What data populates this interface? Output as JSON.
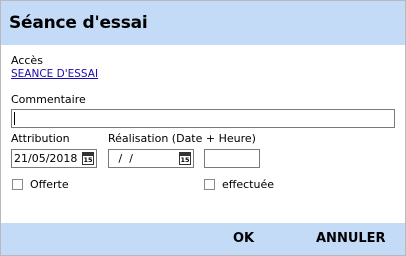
{
  "dialog": {
    "title": "Séance d'essai"
  },
  "acces": {
    "label": "Accès",
    "link_text": "SEANCE D'ESSAI"
  },
  "commentaire": {
    "label": "Commentaire",
    "value": ""
  },
  "attribution": {
    "label": "Attribution",
    "date_value": "21/05/2018"
  },
  "realisation": {
    "label": "Réalisation (Date + Heure)",
    "date_value": " /  /",
    "time_value": ""
  },
  "calendar_icon_text": "15",
  "options": {
    "offerte_label": "Offerte",
    "offerte_checked": false,
    "effectuee_label": "effectuée",
    "effectuee_checked": false
  },
  "buttons": {
    "ok_label": "OK",
    "cancel_label": "ANNULER"
  },
  "colors": {
    "header_bg": "#c3dbf7",
    "link": "#1a0dab"
  }
}
